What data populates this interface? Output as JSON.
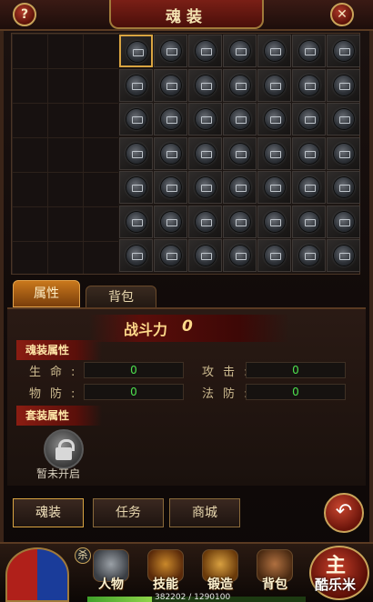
{
  "window": {
    "title": "魂装",
    "help_label": "?",
    "close_label": "✕"
  },
  "grid": {
    "empty_columns": 3,
    "rows": 7,
    "slot_columns": 7,
    "selected_slot": 0,
    "slot_icon": "locked-soul-slot-icon"
  },
  "tabs": [
    {
      "label": "属性",
      "active": true
    },
    {
      "label": "背包",
      "active": false
    }
  ],
  "power": {
    "label": "战斗力",
    "value": "0"
  },
  "sections": {
    "soul_attr": "魂装属性",
    "set_attr": "套装属性"
  },
  "stats": [
    {
      "label": "生命:",
      "value": "0"
    },
    {
      "label": "攻击:",
      "value": "0"
    },
    {
      "label": "物防:",
      "value": "0"
    },
    {
      "label": "法防:",
      "value": "0"
    }
  ],
  "set_bonus": {
    "status": "暂未开启",
    "icon": "lock-icon"
  },
  "buttons": {
    "soul": "魂装",
    "task": "任务",
    "shop": "商城",
    "back": "↶"
  },
  "hud": {
    "kill_badge": "杀",
    "items": [
      {
        "label": "人物",
        "icon": "character-icon"
      },
      {
        "label": "技能",
        "icon": "skill-book-icon"
      },
      {
        "label": "锻造",
        "icon": "forge-anvil-icon"
      },
      {
        "label": "背包",
        "icon": "backpack-icon"
      }
    ],
    "main_label": "主",
    "watermark": "酷乐米",
    "hp_text": "382202 / 1290100",
    "hp_fraction": 0.296
  },
  "colors": {
    "accent_gold": "#d9a441",
    "stat_value_green": "#4ee04e",
    "banner_red": "#8a1d12"
  }
}
